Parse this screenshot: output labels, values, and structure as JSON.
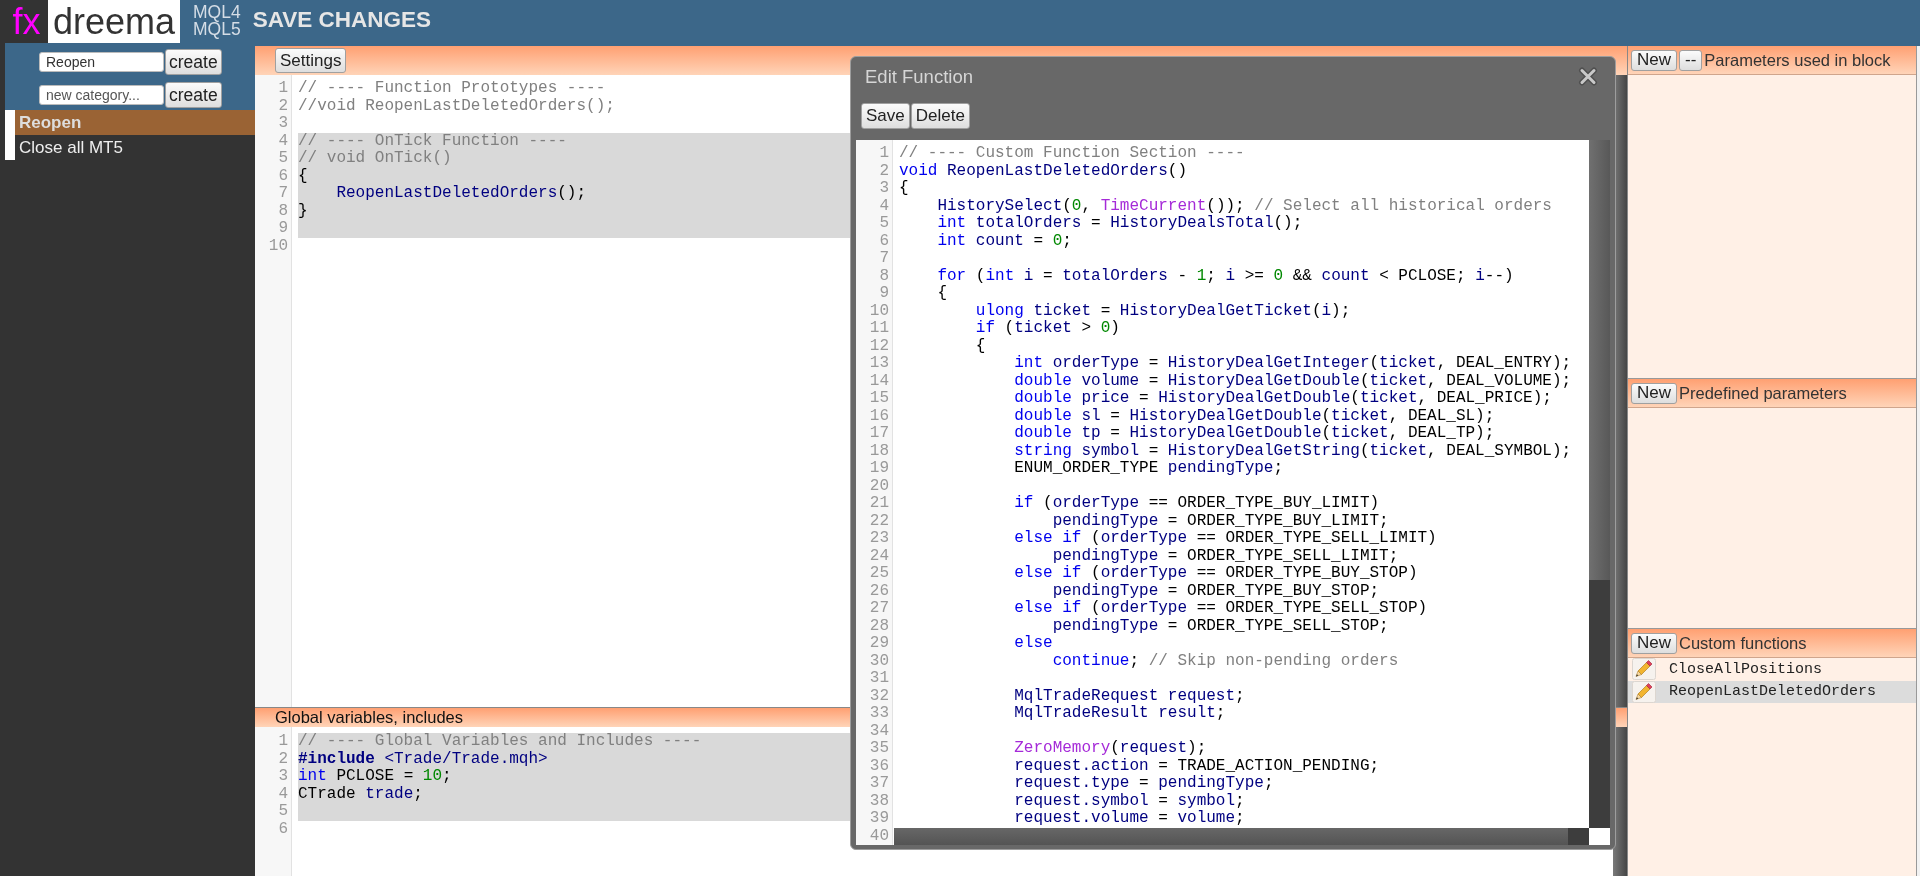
{
  "header": {
    "logo_mark": "fx",
    "logo_text": "dreema",
    "platforms": [
      "MQL4",
      "MQL5"
    ],
    "save_label": "SAVE CHANGES"
  },
  "sidebar": {
    "name_field": {
      "value": "Reopen",
      "button": "create"
    },
    "category_field": {
      "placeholder": "new category...",
      "button": "create"
    },
    "items": [
      {
        "label": "Reopen",
        "selected": true
      },
      {
        "label": "Close all MT5",
        "selected": false
      }
    ]
  },
  "editor": {
    "toolbar_button": "Settings",
    "lines": [
      {
        "number": "1",
        "selected": false,
        "tokens": [
          {
            "kind": "comment",
            "text": "// ---- Function Prototypes ----"
          }
        ]
      },
      {
        "number": "2",
        "selected": false,
        "tokens": [
          {
            "kind": "comment",
            "text": "//void ReopenLastDeletedOrders();"
          }
        ]
      },
      {
        "number": "3",
        "selected": false
      },
      {
        "number": "4",
        "selected": true,
        "tokens": [
          {
            "kind": "comment",
            "text": "// ---- OnTick Function ----"
          }
        ]
      },
      {
        "number": "5",
        "selected": true,
        "tokens": [
          {
            "kind": "comment",
            "text": "// void OnTick()"
          }
        ]
      },
      {
        "number": "6",
        "selected": true,
        "tokens": [
          {
            "kind": "plain",
            "text": "{"
          }
        ]
      },
      {
        "number": "7",
        "selected": true,
        "tokens": [
          {
            "kind": "name",
            "text": "    ReopenLastDeletedOrders"
          },
          {
            "kind": "plain",
            "text": "();"
          }
        ]
      },
      {
        "number": "8",
        "selected": true,
        "tokens": [
          {
            "kind": "plain",
            "text": "}"
          }
        ]
      },
      {
        "number": "9",
        "selected": true
      },
      {
        "number": "10",
        "selected": false
      }
    ]
  },
  "globals": {
    "title": "Global variables, includes",
    "lines": [
      {
        "number": "1",
        "selected": true,
        "tokens": [
          {
            "kind": "comment",
            "text": "// ---- Global Variables and Includes ----"
          }
        ]
      },
      {
        "number": "2",
        "selected": true,
        "tokens": [
          {
            "kind": "directive",
            "text": "#include"
          },
          {
            "kind": "name",
            "text": " <Trade/Trade.mqh>"
          }
        ]
      },
      {
        "number": "3",
        "selected": true,
        "tokens": [
          {
            "kind": "keyword",
            "text": "int"
          },
          {
            "kind": "plain",
            "text": " PCLOSE = "
          },
          {
            "kind": "number",
            "text": "10"
          },
          {
            "kind": "plain",
            "text": ";"
          }
        ]
      },
      {
        "number": "4",
        "selected": true,
        "tokens": [
          {
            "kind": "plain",
            "text": "CTrade "
          },
          {
            "kind": "name",
            "text": "trade"
          },
          {
            "kind": "plain",
            "text": ";"
          }
        ]
      },
      {
        "number": "5",
        "selected": true
      },
      {
        "number": "6",
        "selected": false
      }
    ]
  },
  "dialog": {
    "title": "Edit Function",
    "buttons": [
      "Save",
      "Delete"
    ],
    "lines": [
      {
        "number": "1",
        "tokens": [
          {
            "kind": "comment",
            "text": "// ---- Custom Function Section ----"
          }
        ]
      },
      {
        "number": "2",
        "tokens": [
          {
            "kind": "keyword",
            "text": "void"
          },
          {
            "kind": "name",
            "text": " ReopenLastDeletedOrders"
          },
          {
            "kind": "plain",
            "text": "()"
          }
        ]
      },
      {
        "number": "3",
        "tokens": [
          {
            "kind": "plain",
            "text": "{"
          }
        ]
      },
      {
        "number": "4",
        "tokens": [
          {
            "kind": "name",
            "text": "    HistorySelect"
          },
          {
            "kind": "plain",
            "text": "("
          },
          {
            "kind": "number",
            "text": "0"
          },
          {
            "kind": "plain",
            "text": ", "
          },
          {
            "kind": "builtin",
            "text": "TimeCurrent"
          },
          {
            "kind": "plain",
            "text": "()); "
          },
          {
            "kind": "comment",
            "text": "// Select all historical orders"
          }
        ]
      },
      {
        "number": "5",
        "tokens": [
          {
            "kind": "keyword",
            "text": "    int"
          },
          {
            "kind": "name",
            "text": " totalOrders"
          },
          {
            "kind": "plain",
            "text": " = "
          },
          {
            "kind": "name",
            "text": "HistoryDealsTotal"
          },
          {
            "kind": "plain",
            "text": "();"
          }
        ]
      },
      {
        "number": "6",
        "tokens": [
          {
            "kind": "keyword",
            "text": "    int"
          },
          {
            "kind": "name",
            "text": " count"
          },
          {
            "kind": "plain",
            "text": " = "
          },
          {
            "kind": "number",
            "text": "0"
          },
          {
            "kind": "plain",
            "text": ";"
          }
        ]
      },
      {
        "number": "7"
      },
      {
        "number": "8",
        "tokens": [
          {
            "kind": "keyword",
            "text": "    for"
          },
          {
            "kind": "plain",
            "text": " ("
          },
          {
            "kind": "keyword",
            "text": "int"
          },
          {
            "kind": "name",
            "text": " i"
          },
          {
            "kind": "plain",
            "text": " = "
          },
          {
            "kind": "name",
            "text": "totalOrders"
          },
          {
            "kind": "plain",
            "text": " - "
          },
          {
            "kind": "number",
            "text": "1"
          },
          {
            "kind": "plain",
            "text": "; "
          },
          {
            "kind": "name",
            "text": "i"
          },
          {
            "kind": "plain",
            "text": " >= "
          },
          {
            "kind": "number",
            "text": "0"
          },
          {
            "kind": "plain",
            "text": " && "
          },
          {
            "kind": "name",
            "text": "count"
          },
          {
            "kind": "plain",
            "text": " < PCLOSE; "
          },
          {
            "kind": "name",
            "text": "i"
          },
          {
            "kind": "plain",
            "text": "--)"
          }
        ]
      },
      {
        "number": "9",
        "tokens": [
          {
            "kind": "plain",
            "text": "    {"
          }
        ]
      },
      {
        "number": "10",
        "tokens": [
          {
            "kind": "keyword",
            "text": "        ulong"
          },
          {
            "kind": "name",
            "text": " ticket"
          },
          {
            "kind": "plain",
            "text": " = "
          },
          {
            "kind": "name",
            "text": "HistoryDealGetTicket"
          },
          {
            "kind": "plain",
            "text": "("
          },
          {
            "kind": "name",
            "text": "i"
          },
          {
            "kind": "plain",
            "text": ");"
          }
        ]
      },
      {
        "number": "11",
        "tokens": [
          {
            "kind": "keyword",
            "text": "        if"
          },
          {
            "kind": "plain",
            "text": " ("
          },
          {
            "kind": "name",
            "text": "ticket"
          },
          {
            "kind": "plain",
            "text": " > "
          },
          {
            "kind": "number",
            "text": "0"
          },
          {
            "kind": "plain",
            "text": ")"
          }
        ]
      },
      {
        "number": "12",
        "tokens": [
          {
            "kind": "plain",
            "text": "        {"
          }
        ]
      },
      {
        "number": "13",
        "tokens": [
          {
            "kind": "keyword",
            "text": "            int"
          },
          {
            "kind": "name",
            "text": " orderType"
          },
          {
            "kind": "plain",
            "text": " = "
          },
          {
            "kind": "name",
            "text": "HistoryDealGetInteger"
          },
          {
            "kind": "plain",
            "text": "("
          },
          {
            "kind": "name",
            "text": "ticket"
          },
          {
            "kind": "plain",
            "text": ", DEAL_ENTRY);"
          }
        ]
      },
      {
        "number": "14",
        "tokens": [
          {
            "kind": "keyword",
            "text": "            double"
          },
          {
            "kind": "name",
            "text": " volume"
          },
          {
            "kind": "plain",
            "text": " = "
          },
          {
            "kind": "name",
            "text": "HistoryDealGetDouble"
          },
          {
            "kind": "plain",
            "text": "("
          },
          {
            "kind": "name",
            "text": "ticket"
          },
          {
            "kind": "plain",
            "text": ", DEAL_VOLUME);"
          }
        ]
      },
      {
        "number": "15",
        "tokens": [
          {
            "kind": "keyword",
            "text": "            double"
          },
          {
            "kind": "name",
            "text": " price"
          },
          {
            "kind": "plain",
            "text": " = "
          },
          {
            "kind": "name",
            "text": "HistoryDealGetDouble"
          },
          {
            "kind": "plain",
            "text": "("
          },
          {
            "kind": "name",
            "text": "ticket"
          },
          {
            "kind": "plain",
            "text": ", DEAL_PRICE);"
          }
        ]
      },
      {
        "number": "16",
        "tokens": [
          {
            "kind": "keyword",
            "text": "            double"
          },
          {
            "kind": "name",
            "text": " sl"
          },
          {
            "kind": "plain",
            "text": " = "
          },
          {
            "kind": "name",
            "text": "HistoryDealGetDouble"
          },
          {
            "kind": "plain",
            "text": "("
          },
          {
            "kind": "name",
            "text": "ticket"
          },
          {
            "kind": "plain",
            "text": ", DEAL_SL);"
          }
        ]
      },
      {
        "number": "17",
        "tokens": [
          {
            "kind": "keyword",
            "text": "            double"
          },
          {
            "kind": "name",
            "text": " tp"
          },
          {
            "kind": "plain",
            "text": " = "
          },
          {
            "kind": "name",
            "text": "HistoryDealGetDouble"
          },
          {
            "kind": "plain",
            "text": "("
          },
          {
            "kind": "name",
            "text": "ticket"
          },
          {
            "kind": "plain",
            "text": ", DEAL_TP);"
          }
        ]
      },
      {
        "number": "18",
        "tokens": [
          {
            "kind": "keyword",
            "text": "            string"
          },
          {
            "kind": "name",
            "text": " symbol"
          },
          {
            "kind": "plain",
            "text": " = "
          },
          {
            "kind": "name",
            "text": "HistoryDealGetString"
          },
          {
            "kind": "plain",
            "text": "("
          },
          {
            "kind": "name",
            "text": "ticket"
          },
          {
            "kind": "plain",
            "text": ", DEAL_SYMBOL);"
          }
        ]
      },
      {
        "number": "19",
        "tokens": [
          {
            "kind": "plain",
            "text": "            ENUM_ORDER_TYPE "
          },
          {
            "kind": "name",
            "text": "pendingType"
          },
          {
            "kind": "plain",
            "text": ";"
          }
        ]
      },
      {
        "number": "20"
      },
      {
        "number": "21",
        "tokens": [
          {
            "kind": "keyword",
            "text": "            if"
          },
          {
            "kind": "plain",
            "text": " ("
          },
          {
            "kind": "name",
            "text": "orderType"
          },
          {
            "kind": "plain",
            "text": " == ORDER_TYPE_BUY_LIMIT)"
          }
        ]
      },
      {
        "number": "22",
        "tokens": [
          {
            "kind": "name",
            "text": "                pendingType"
          },
          {
            "kind": "plain",
            "text": " = ORDER_TYPE_BUY_LIMIT;"
          }
        ]
      },
      {
        "number": "23",
        "tokens": [
          {
            "kind": "keyword",
            "text": "            else if"
          },
          {
            "kind": "plain",
            "text": " ("
          },
          {
            "kind": "name",
            "text": "orderType"
          },
          {
            "kind": "plain",
            "text": " == ORDER_TYPE_SELL_LIMIT)"
          }
        ]
      },
      {
        "number": "24",
        "tokens": [
          {
            "kind": "name",
            "text": "                pendingType"
          },
          {
            "kind": "plain",
            "text": " = ORDER_TYPE_SELL_LIMIT;"
          }
        ]
      },
      {
        "number": "25",
        "tokens": [
          {
            "kind": "keyword",
            "text": "            else if"
          },
          {
            "kind": "plain",
            "text": " ("
          },
          {
            "kind": "name",
            "text": "orderType"
          },
          {
            "kind": "plain",
            "text": " == ORDER_TYPE_BUY_STOP)"
          }
        ]
      },
      {
        "number": "26",
        "tokens": [
          {
            "kind": "name",
            "text": "                pendingType"
          },
          {
            "kind": "plain",
            "text": " = ORDER_TYPE_BUY_STOP;"
          }
        ]
      },
      {
        "number": "27",
        "tokens": [
          {
            "kind": "keyword",
            "text": "            else if"
          },
          {
            "kind": "plain",
            "text": " ("
          },
          {
            "kind": "name",
            "text": "orderType"
          },
          {
            "kind": "plain",
            "text": " == ORDER_TYPE_SELL_STOP)"
          }
        ]
      },
      {
        "number": "28",
        "tokens": [
          {
            "kind": "name",
            "text": "                pendingType"
          },
          {
            "kind": "plain",
            "text": " = ORDER_TYPE_SELL_STOP;"
          }
        ]
      },
      {
        "number": "29",
        "tokens": [
          {
            "kind": "keyword",
            "text": "            else"
          }
        ]
      },
      {
        "number": "30",
        "tokens": [
          {
            "kind": "keyword",
            "text": "                continue"
          },
          {
            "kind": "plain",
            "text": "; "
          },
          {
            "kind": "comment",
            "text": "// Skip non-pending orders"
          }
        ]
      },
      {
        "number": "31"
      },
      {
        "number": "32",
        "tokens": [
          {
            "kind": "name",
            "text": "            MqlTradeRequest request"
          },
          {
            "kind": "plain",
            "text": ";"
          }
        ]
      },
      {
        "number": "33",
        "tokens": [
          {
            "kind": "name",
            "text": "            MqlTradeResult result"
          },
          {
            "kind": "plain",
            "text": ";"
          }
        ]
      },
      {
        "number": "34"
      },
      {
        "number": "35",
        "tokens": [
          {
            "kind": "builtin",
            "text": "            ZeroMemory"
          },
          {
            "kind": "plain",
            "text": "("
          },
          {
            "kind": "name",
            "text": "request"
          },
          {
            "kind": "plain",
            "text": ");"
          }
        ]
      },
      {
        "number": "36",
        "tokens": [
          {
            "kind": "name",
            "text": "            request.action"
          },
          {
            "kind": "plain",
            "text": " = TRADE_ACTION_PENDING;"
          }
        ]
      },
      {
        "number": "37",
        "tokens": [
          {
            "kind": "name",
            "text": "            request.type"
          },
          {
            "kind": "plain",
            "text": " = "
          },
          {
            "kind": "name",
            "text": "pendingType"
          },
          {
            "kind": "plain",
            "text": ";"
          }
        ]
      },
      {
        "number": "38",
        "tokens": [
          {
            "kind": "name",
            "text": "            request.symbol"
          },
          {
            "kind": "plain",
            "text": " = "
          },
          {
            "kind": "name",
            "text": "symbol"
          },
          {
            "kind": "plain",
            "text": ";"
          }
        ]
      },
      {
        "number": "39",
        "tokens": [
          {
            "kind": "name",
            "text": "            request.volume"
          },
          {
            "kind": "plain",
            "text": " = "
          },
          {
            "kind": "name",
            "text": "volume"
          },
          {
            "kind": "plain",
            "text": ";"
          }
        ]
      },
      {
        "number": "40"
      }
    ]
  },
  "right_panel": {
    "sections": [
      {
        "buttons": [
          "New",
          "--"
        ],
        "title": "Parameters used in block"
      },
      {
        "buttons": [
          "New"
        ],
        "title": "Predefined parameters"
      },
      {
        "buttons": [
          "New"
        ],
        "title": "Custom functions",
        "items": [
          {
            "label": "CloseAllPositions",
            "selected": false
          },
          {
            "label": "ReopenLastDeletedOrders",
            "selected": true
          }
        ]
      }
    ]
  }
}
